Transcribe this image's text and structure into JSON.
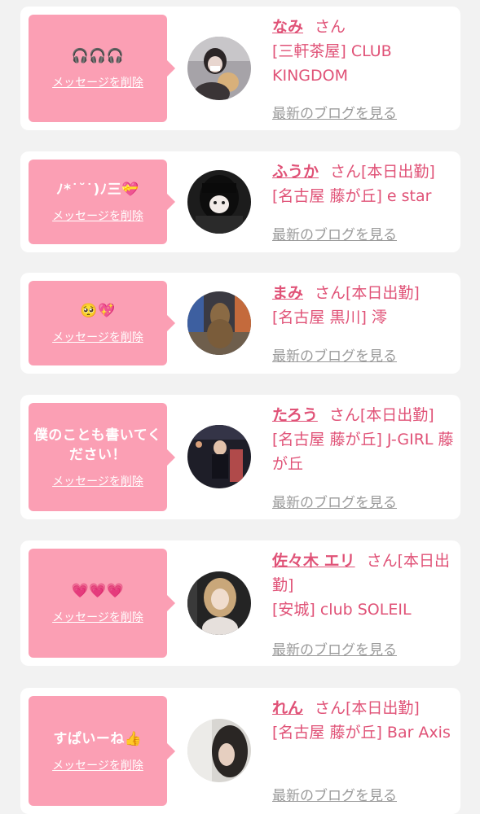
{
  "messages": [
    {
      "message": "🎧🎧🎧",
      "delete_label": "メッセージを削除",
      "name": "なみ",
      "suffix": "さん",
      "shop": "[三軒茶屋] CLUB KINGDOM",
      "blog_label": "最新のブログを見る",
      "avatar_color": "#a6a3a8"
    },
    {
      "message": "ﾉ*˙˘˙)ﾉ三💝",
      "delete_label": "メッセージを削除",
      "name": "ふうか",
      "suffix": "さん[本日出勤]",
      "shop": "[名古屋 藤が丘] e star",
      "blog_label": "最新のブログを見る",
      "avatar_color": "#2a2a2a"
    },
    {
      "message": "🥺💖",
      "delete_label": "メッセージを削除",
      "name": "まみ",
      "suffix": "さん[本日出勤]",
      "shop": "[名古屋 黒川] 澪",
      "blog_label": "最新のブログを見る",
      "avatar_color": "#5a4a3a"
    },
    {
      "message": "僕のことも書いてください！",
      "delete_label": "メッセージを削除",
      "name": "たろう",
      "suffix": "さん[本日出勤]",
      "shop": "[名古屋 藤が丘] J-GIRL 藤が丘",
      "blog_label": "最新のブログを見る",
      "avatar_color": "#1e1e2a"
    },
    {
      "message": "💗💗💗",
      "delete_label": "メッセージを削除",
      "name": "佐々木 エリ",
      "suffix": "さん[本日出勤]",
      "shop": "[安城] club SOLEIL",
      "blog_label": "最新のブログを見る",
      "avatar_color": "#c9b8a6"
    },
    {
      "message": "すぱいーね👍",
      "delete_label": "メッセージを削除",
      "name": "れん",
      "suffix": "さん[本日出勤]",
      "shop": "[名古屋 藤が丘] Bar Axis",
      "blog_label": "最新のブログを見る",
      "avatar_color": "#3a3634"
    }
  ]
}
